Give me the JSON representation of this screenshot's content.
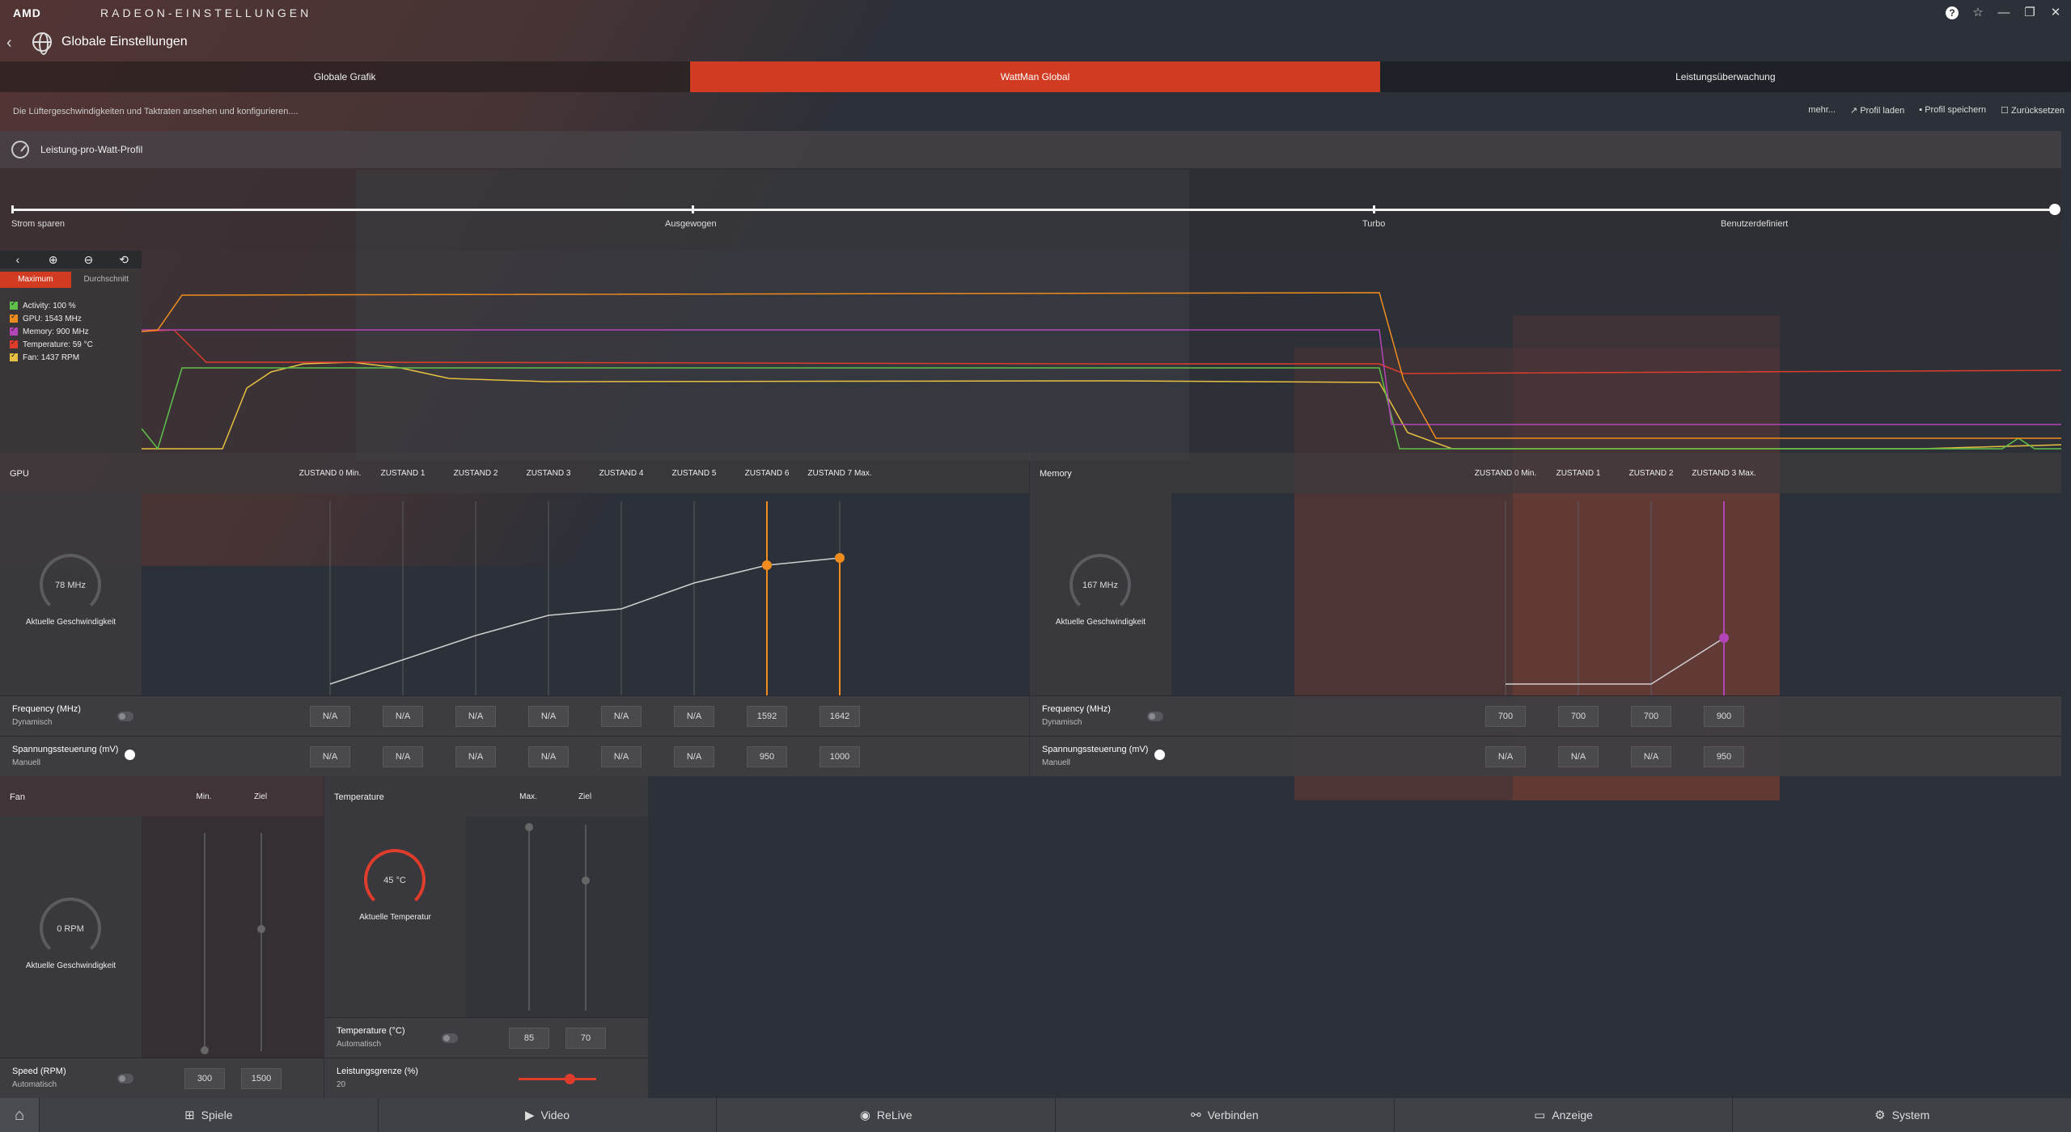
{
  "titlebar": {
    "brand": "AMD",
    "app_name": "RADEON-EINSTELLUNGEN"
  },
  "header": {
    "title": "Globale Einstellungen"
  },
  "tabs": [
    {
      "label": "Globale Grafik"
    },
    {
      "label": "WattMan Global"
    },
    {
      "label": "Leistungsüberwachung"
    }
  ],
  "subbar": {
    "description": "Die Lüftergeschwindigkeiten und Taktraten ansehen und konfigurieren....",
    "more": "mehr...",
    "load_profile": "Profil laden",
    "save_profile": "Profil speichern",
    "reset": "Zurücksetzen"
  },
  "profile": {
    "title": "Leistung-pro-Watt-Profil",
    "options": [
      "Strom sparen",
      "Ausgewogen",
      "Turbo",
      "Benutzerdefiniert"
    ]
  },
  "monitor": {
    "mode_max": "Maximum",
    "mode_avg": "Durchschnitt",
    "legend": [
      {
        "label": "Activity: 100 %",
        "color": "#5fbf4a"
      },
      {
        "label": "GPU: 1543 MHz",
        "color": "#f08c1e"
      },
      {
        "label": "Memory: 900 MHz",
        "color": "#b445b8"
      },
      {
        "label": "Temperature: 59 °C",
        "color": "#e03c2c"
      },
      {
        "label": "Fan: 1437 RPM",
        "color": "#e6c040"
      }
    ]
  },
  "gpu": {
    "title": "GPU",
    "states": [
      "ZUSTAND 0 Min.",
      "ZUSTAND 1",
      "ZUSTAND 2",
      "ZUSTAND 3",
      "ZUSTAND 4",
      "ZUSTAND 5",
      "ZUSTAND 6",
      "ZUSTAND 7 Max."
    ],
    "gauge_value": "78 MHz",
    "gauge_label": "Aktuelle Geschwindigkeit",
    "freq_label": "Frequency (MHz)",
    "freq_sub": "Dynamisch",
    "freq_values": [
      "N/A",
      "N/A",
      "N/A",
      "N/A",
      "N/A",
      "N/A",
      "1592",
      "1642"
    ],
    "volt_label": "Spannungssteuerung (mV)",
    "volt_sub": "Manuell",
    "volt_values": [
      "N/A",
      "N/A",
      "N/A",
      "N/A",
      "N/A",
      "N/A",
      "950",
      "1000"
    ]
  },
  "memory": {
    "title": "Memory",
    "states": [
      "ZUSTAND 0 Min.",
      "ZUSTAND 1",
      "ZUSTAND 2",
      "ZUSTAND 3 Max."
    ],
    "gauge_value": "167 MHz",
    "gauge_label": "Aktuelle Geschwindigkeit",
    "freq_label": "Frequency (MHz)",
    "freq_sub": "Dynamisch",
    "freq_values": [
      "700",
      "700",
      "700",
      "900"
    ],
    "volt_label": "Spannungssteuerung (mV)",
    "volt_sub": "Manuell",
    "volt_values": [
      "N/A",
      "N/A",
      "N/A",
      "950"
    ]
  },
  "fan": {
    "title": "Fan",
    "col_min": "Min.",
    "col_target": "Ziel",
    "gauge_value": "0 RPM",
    "gauge_label": "Aktuelle Geschwindigkeit",
    "speed_label": "Speed (RPM)",
    "speed_sub": "Automatisch",
    "min_value": "300",
    "target_value": "1500"
  },
  "temperature": {
    "title": "Temperature",
    "col_max": "Max.",
    "col_target": "Ziel",
    "gauge_value": "45 °C",
    "gauge_label": "Aktuelle Temperatur",
    "temp_label": "Temperature (°C)",
    "temp_sub": "Automatisch",
    "max_value": "85",
    "target_value": "70",
    "power_label": "Leistungsgrenze (%)",
    "power_value": "20"
  },
  "bottom_nav": [
    {
      "label": "Spiele",
      "icon": "gamepad-icon"
    },
    {
      "label": "Video",
      "icon": "play-icon"
    },
    {
      "label": "ReLive",
      "icon": "relive-icon"
    },
    {
      "label": "Verbinden",
      "icon": "share-icon"
    },
    {
      "label": "Anzeige",
      "icon": "monitor-icon"
    },
    {
      "label": "System",
      "icon": "system-icon"
    }
  ],
  "colors": {
    "accent": "#d13b22",
    "orange": "#f08c1e",
    "magenta": "#b445b8"
  }
}
